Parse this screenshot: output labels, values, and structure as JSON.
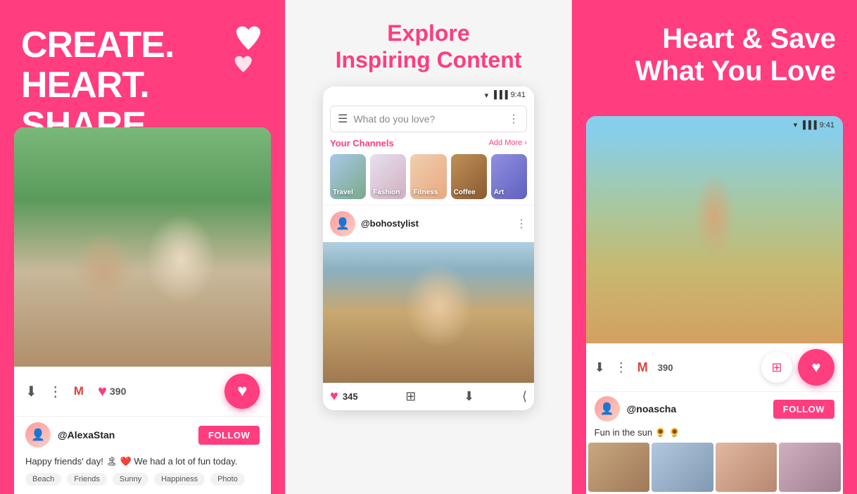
{
  "left": {
    "headline_line1": "CREATE.",
    "headline_line2": "HEART.",
    "headline_line3": "SHARE.",
    "photo_alt": "Two women laughing together",
    "download_icon": "⬇",
    "share_icon": "⟨",
    "mail_icon": "M",
    "heart_count": "390",
    "heart_icon": "♥",
    "username": "@AlexaStan",
    "follow_label": "FOLLOW",
    "caption": "Happy friends' day! 🏝 ❤️ We had a lot of fun today.",
    "tags": [
      "Beach",
      "Friends",
      "Sunny",
      "Happiness",
      "Photo"
    ]
  },
  "mid": {
    "headline_line1": "Explore",
    "headline_line2": "Inspiring Content",
    "status_time": "9:41",
    "search_placeholder": "What do you love?",
    "channels_title": "Your Channels",
    "add_more_label": "Add More ›",
    "channels": [
      {
        "label": "Travel"
      },
      {
        "label": "Fashion"
      },
      {
        "label": "Fitness"
      },
      {
        "label": "Coffee"
      },
      {
        "label": "Art"
      }
    ],
    "post_username": "@bohostylist",
    "like_count": "345",
    "heart_icon": "♥",
    "menu_icon": "⋮"
  },
  "right": {
    "headline_line1": "Heart & Save",
    "headline_line2": "What You Love",
    "status_time": "9:41",
    "download_icon": "⬇",
    "share_icon": "⟨",
    "mail_icon": "M",
    "heart_count": "390",
    "heart_icon": "♥",
    "username": "@noascha",
    "follow_label": "FOLLOW",
    "caption": "Fun in the sun 🌻 🌻",
    "photo_alt": "Woman in field with arms outstretched"
  }
}
